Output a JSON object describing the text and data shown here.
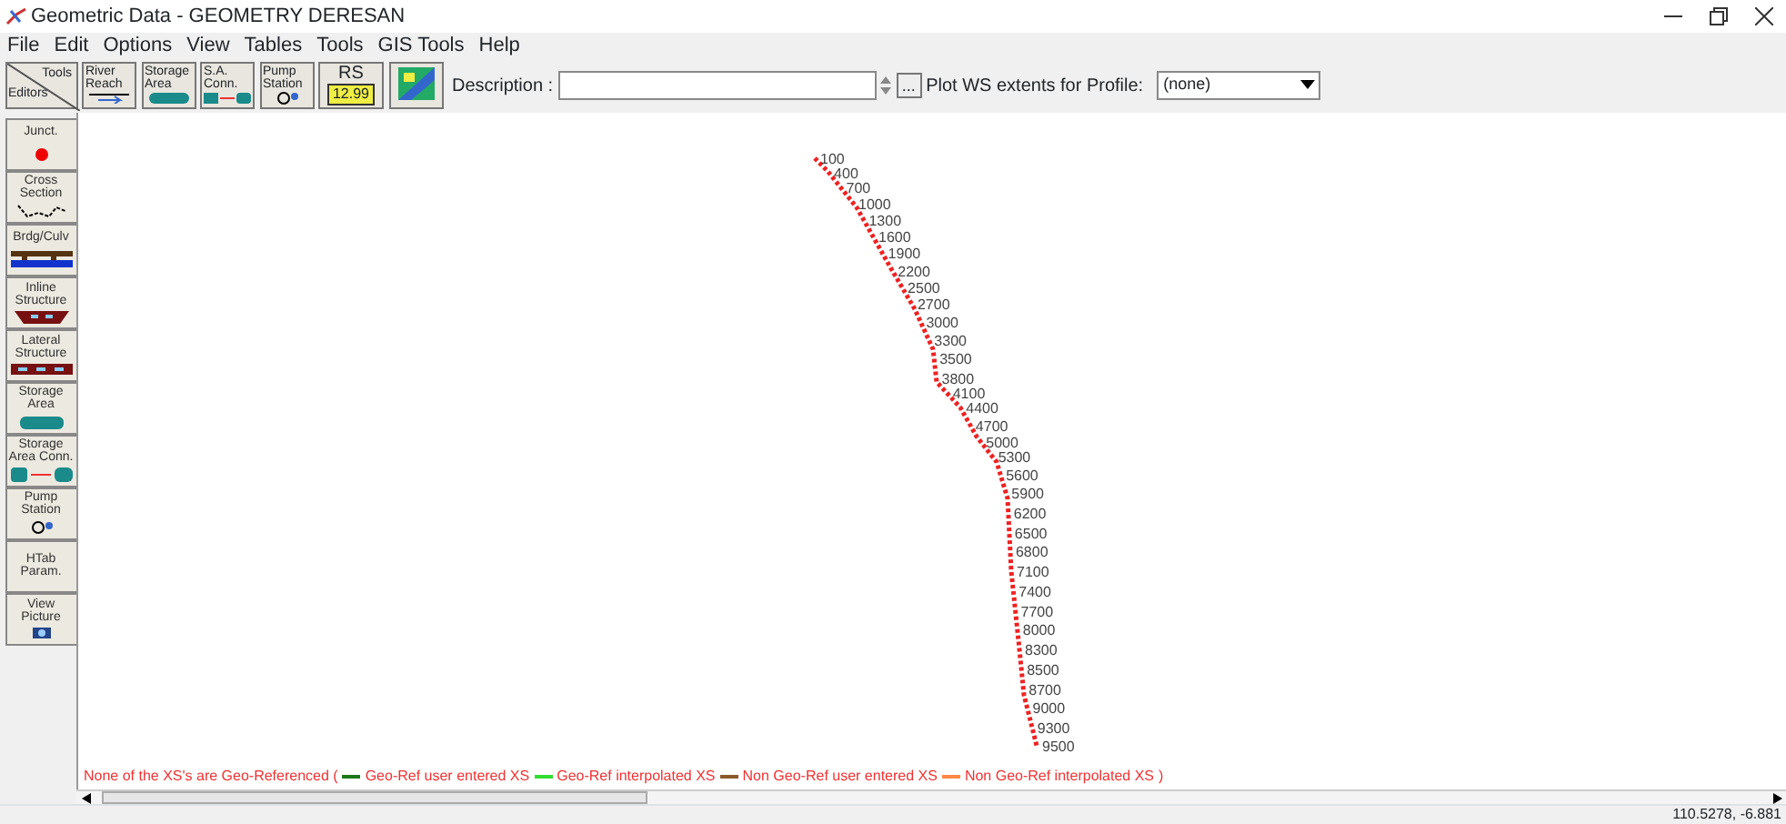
{
  "window": {
    "title": "Geometric Data - GEOMETRY DERESAN"
  },
  "menu": [
    "File",
    "Edit",
    "Options",
    "View",
    "Tables",
    "Tools",
    "GIS Tools",
    "Help"
  ],
  "toolbar": {
    "tools_label": "Tools",
    "editors_label": "Editors",
    "buttons": [
      {
        "label": "River Reach"
      },
      {
        "label": "Storage Area"
      },
      {
        "label": "S.A. Conn."
      },
      {
        "label": "Pump Station"
      }
    ],
    "rs_button": {
      "label": "RS",
      "value": "12.99"
    },
    "description_label": "Description :",
    "browse_button": "...",
    "profile_label": "Plot WS extents for Profile:",
    "profile_value": "(none)"
  },
  "palette": [
    {
      "label": "Junct."
    },
    {
      "label": "Cross Section"
    },
    {
      "label": "Brdg/Culv"
    },
    {
      "label": "Inline Structure"
    },
    {
      "label": "Lateral Structure"
    },
    {
      "label": "Storage Area"
    },
    {
      "label": "Storage Area Conn."
    },
    {
      "label": "Pump Station"
    },
    {
      "label": "HTab Param."
    },
    {
      "label": "View Picture"
    }
  ],
  "stations": [
    "100",
    "400",
    "700",
    "1000",
    "1300",
    "1600",
    "1900",
    "2200",
    "2500",
    "2700",
    "3000",
    "3300",
    "3500",
    "3800",
    "4100",
    "4400",
    "4700",
    "5000",
    "5300",
    "5600",
    "5900",
    "6200",
    "6500",
    "6800",
    "7100",
    "7400",
    "7700",
    "8000",
    "8300",
    "8500",
    "8700",
    "9000",
    "9300",
    "9500"
  ],
  "legend": {
    "prefix": "None of the XS's are Geo-Referenced (",
    "suffix": ")",
    "items": [
      {
        "label": "Geo-Ref user entered XS",
        "color": "#1a7a1a"
      },
      {
        "label": "Geo-Ref interpolated XS",
        "color": "#33dd33"
      },
      {
        "label": "Non Geo-Ref user entered XS",
        "color": "#8a5a2a"
      },
      {
        "label": "Non Geo-Ref interpolated XS",
        "color": "#ff8844"
      }
    ]
  },
  "status_bar": {
    "coordinates": "110.5278, -6.881"
  }
}
